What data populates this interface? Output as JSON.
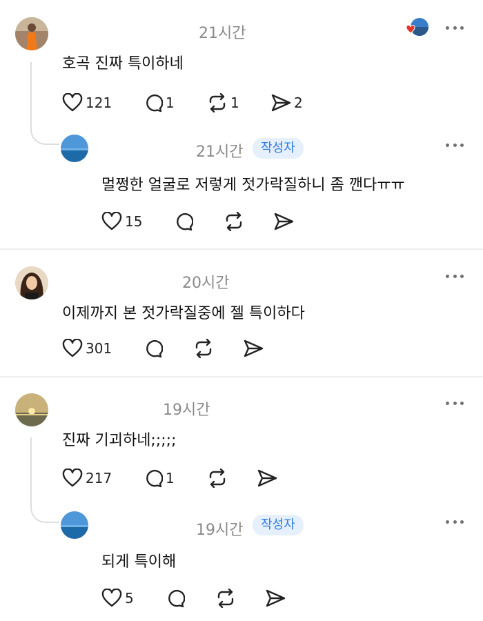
{
  "threads": [
    {
      "time": "21시간",
      "text": "호곡 진짜 특이하네",
      "likes": "121",
      "comments": "1",
      "reposts": "1",
      "shares": "2",
      "reply": {
        "time": "21시간",
        "badge": "작성자",
        "text": "멀쩡한 얼굴로 저렇게 젓가락질하니 좀 깬다ㅠㅠ",
        "likes": "15"
      }
    },
    {
      "time": "20시간",
      "text": "이제까지 본 젓가락질중에 젤 특이하다",
      "likes": "301"
    },
    {
      "time": "19시간",
      "text": "진짜 기괴하네;;;;;",
      "likes": "217",
      "comments": "1",
      "reply": {
        "time": "19시간",
        "badge": "작성자",
        "text": "되게 특이해",
        "likes": "5"
      }
    }
  ],
  "colors": {
    "badge_text": "#2a7be0",
    "badge_bg": "#e6f0fc",
    "meta": "#8a8a8a",
    "heart_reaction": "#e5322d"
  }
}
